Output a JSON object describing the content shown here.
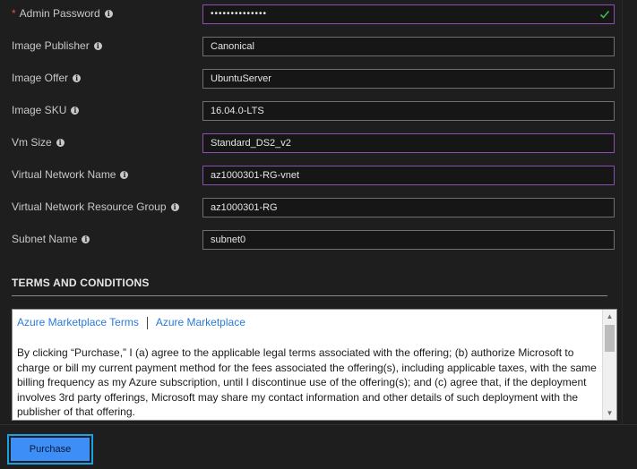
{
  "form": {
    "fields": [
      {
        "label": "Admin Password",
        "required": true,
        "value": "••••••••••••••",
        "valid": true
      },
      {
        "label": "Image Publisher",
        "value": "Canonical"
      },
      {
        "label": "Image Offer",
        "value": "UbuntuServer"
      },
      {
        "label": "Image SKU",
        "value": "16.04.0-LTS"
      },
      {
        "label": "Vm Size",
        "value": "Standard_DS2_v2"
      },
      {
        "label": "Virtual Network Name",
        "value": "az1000301-RG-vnet"
      },
      {
        "label": "Virtual Network Resource Group",
        "value": "az1000301-RG"
      },
      {
        "label": "Subnet Name",
        "value": "subnet0"
      }
    ],
    "required_marker": "*"
  },
  "terms": {
    "heading": "TERMS AND CONDITIONS",
    "links": [
      "Azure Marketplace Terms",
      "Azure Marketplace"
    ],
    "body": "By clicking “Purchase,” I (a) agree to the applicable legal terms associated with the offering; (b) authorize Microsoft to charge or bill my current payment method for the fees associated the offering(s), including applicable taxes, with the same billing frequency as my Azure subscription, until I discontinue use of the offering(s); and (c) agree that, if the deployment involves 3rd party offerings, Microsoft may share my contact information and other details of such deployment with the publisher of that offering."
  },
  "footer": {
    "purchase_label": "Purchase"
  },
  "colors": {
    "accent": "#1ba1e2",
    "button": "#3e8ef7",
    "link": "#2a7bd6",
    "valid": "#3fb950",
    "focus_border": "#8b4fb0"
  },
  "icons": {
    "info": "info-icon",
    "valid": "checkmark-icon"
  }
}
